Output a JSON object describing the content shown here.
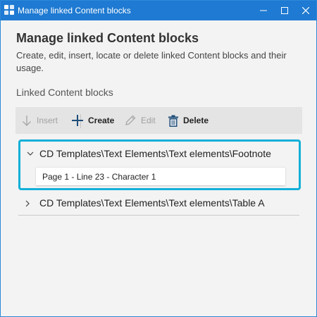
{
  "window": {
    "title": "Manage linked Content blocks",
    "controls": [
      "minimize-icon",
      "maximize-icon",
      "close-icon"
    ]
  },
  "header": {
    "title": "Manage linked Content blocks",
    "description": "Create, edit, insert, locate or delete linked Content blocks and their usage."
  },
  "section": {
    "label": "Linked Content blocks"
  },
  "toolbar": {
    "insert": {
      "label": "Insert",
      "icon": "arrow-down-icon",
      "enabled": false
    },
    "create": {
      "label": "Create",
      "icon": "plus-icon",
      "enabled": true
    },
    "edit": {
      "label": "Edit",
      "icon": "pencil-icon",
      "enabled": false
    },
    "delete": {
      "label": "Delete",
      "icon": "trash-icon",
      "enabled": true
    }
  },
  "tree": {
    "items": [
      {
        "label": "CD Templates\\Text Elements\\Text elements\\Footnote",
        "expanded": true,
        "selected": true,
        "usages": [
          "Page 1 - Line 23 - Character 1"
        ]
      },
      {
        "label": "CD Templates\\Text Elements\\Text elements\\Table A",
        "expanded": false,
        "selected": false,
        "usages": []
      }
    ]
  },
  "colors": {
    "titlebar": "#1e7ad2",
    "selection_border": "#12b0d8",
    "background": "#f3f3f3",
    "toolbar": "#e4e4e4"
  }
}
